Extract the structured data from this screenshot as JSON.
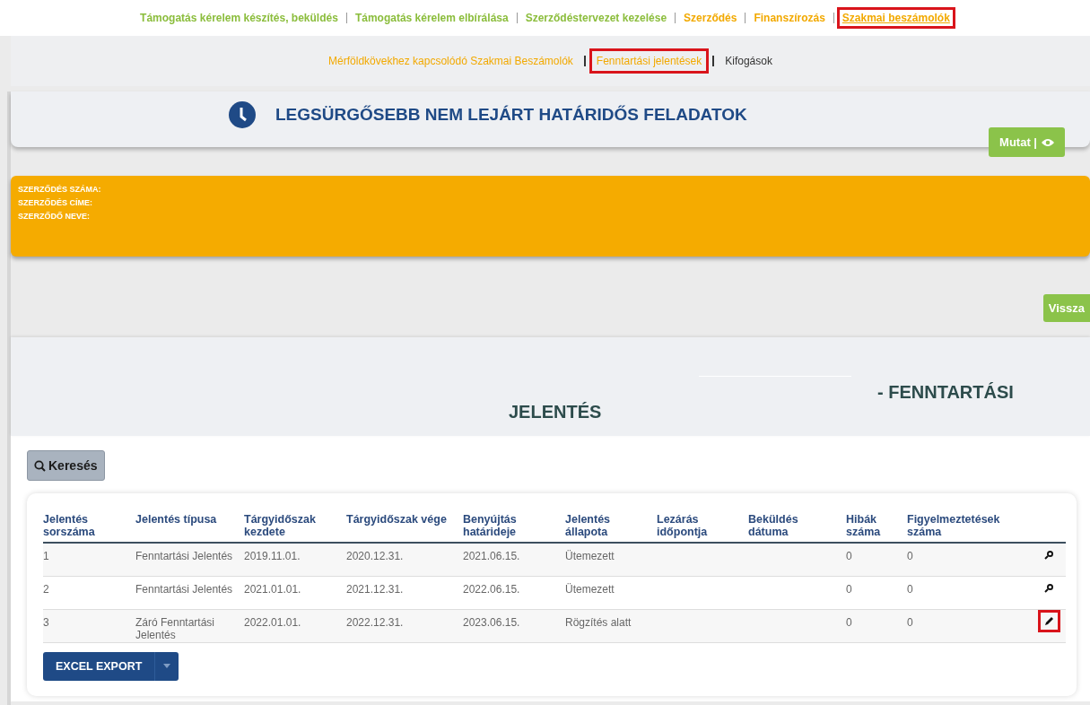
{
  "top_nav": [
    {
      "label": "Támogatás kérelem készítés, beküldés",
      "color": "#8bbd3c",
      "selected": false,
      "highlighted": false
    },
    {
      "label": "Támogatás kérelem elbírálása",
      "color": "#8bbd3c",
      "selected": false,
      "highlighted": false
    },
    {
      "label": "Szerződéstervezet kezelése",
      "color": "#8bbd3c",
      "selected": false,
      "highlighted": false
    },
    {
      "label": "Szerződés",
      "color": "#f2a900",
      "selected": false,
      "highlighted": false
    },
    {
      "label": "Finanszírozás",
      "color": "#f2a900",
      "selected": false,
      "highlighted": false
    },
    {
      "label": "Szakmai beszámolók",
      "color": "#f2a900",
      "selected": true,
      "highlighted": true
    }
  ],
  "sub_nav": [
    {
      "label": "Mérföldkövekhez kapcsolódó Szakmai Beszámolók",
      "color": "#f2a900",
      "highlighted": false
    },
    {
      "label": "Fenntartási jelentések",
      "color": "#f2a900",
      "highlighted": true
    },
    {
      "label": "Kifogások",
      "color": "#333333",
      "highlighted": false
    }
  ],
  "tasks_panel": {
    "title": "LEGSÜRGŐSEBB NEM LEJÁRT HATÁRIDŐS FELADATOK",
    "button": "Mutat |"
  },
  "contract_info": [
    "SZERZŐDÉS SZÁMA:",
    "SZERZŐDÉS CÍME:",
    "SZERZŐDŐ NEVE:"
  ],
  "back_button": "Vissza",
  "section": {
    "title_right": "- FENNTARTÁSI",
    "title_center": "JELENTÉS"
  },
  "search_button": "Keresés",
  "table": {
    "columns": [
      "Jelentés sorszáma",
      "Jelentés típusa",
      "Tárgyidőszak kezdete",
      "Tárgyidőszak vége",
      "Benyújtás határideje",
      "Jelentés állapota",
      "Lezárás időpontja",
      "Beküldés dátuma",
      "Hibák száma",
      "Figyelmeztetések száma"
    ],
    "rows": [
      {
        "cells": [
          "1",
          "Fenntartási Jelentés",
          "2019.11.01.",
          "2020.12.31.",
          "2021.06.15.",
          "Ütemezett",
          "",
          "",
          "0",
          "0"
        ],
        "kind": "view",
        "highlighted": false
      },
      {
        "cells": [
          "2",
          "Fenntartási Jelentés",
          "2021.01.01.",
          "2021.12.31.",
          "2022.06.15.",
          "Ütemezett",
          "",
          "",
          "0",
          "0"
        ],
        "kind": "view",
        "highlighted": false
      },
      {
        "cells": [
          "3",
          "Záró Fenntartási Jelentés",
          "2022.01.01.",
          "2022.12.31.",
          "2023.06.15.",
          "Rögzítés alatt",
          "",
          "",
          "0",
          "0"
        ],
        "kind": "edit",
        "highlighted": true
      }
    ]
  },
  "export_button": "EXCEL EXPORT"
}
